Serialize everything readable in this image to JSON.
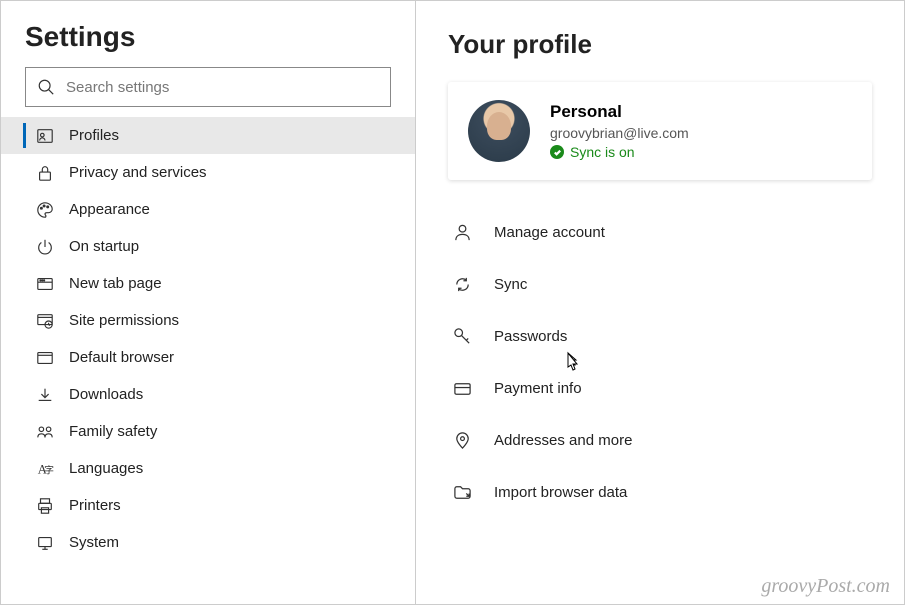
{
  "sidebar": {
    "title": "Settings",
    "search_placeholder": "Search settings",
    "items": [
      {
        "label": "Profiles",
        "selected": true
      },
      {
        "label": "Privacy and services",
        "selected": false
      },
      {
        "label": "Appearance",
        "selected": false
      },
      {
        "label": "On startup",
        "selected": false
      },
      {
        "label": "New tab page",
        "selected": false
      },
      {
        "label": "Site permissions",
        "selected": false
      },
      {
        "label": "Default browser",
        "selected": false
      },
      {
        "label": "Downloads",
        "selected": false
      },
      {
        "label": "Family safety",
        "selected": false
      },
      {
        "label": "Languages",
        "selected": false
      },
      {
        "label": "Printers",
        "selected": false
      },
      {
        "label": "System",
        "selected": false
      }
    ]
  },
  "main": {
    "title": "Your profile",
    "profile": {
      "name": "Personal",
      "email": "groovybrian@live.com",
      "sync_status": "Sync is on"
    },
    "options": [
      {
        "label": "Manage account"
      },
      {
        "label": "Sync"
      },
      {
        "label": "Passwords"
      },
      {
        "label": "Payment info"
      },
      {
        "label": "Addresses and more"
      },
      {
        "label": "Import browser data"
      }
    ]
  },
  "watermark": "groovyPost.com"
}
